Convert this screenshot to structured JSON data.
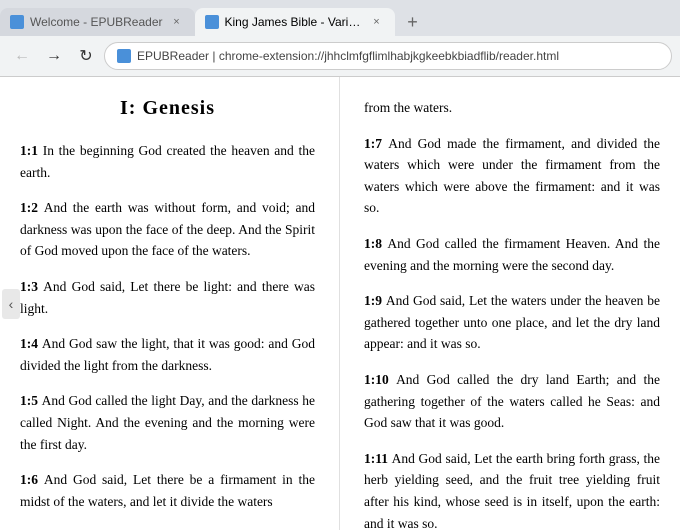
{
  "browser": {
    "tabs": [
      {
        "id": "tab1",
        "label": "Welcome - EPUBReader",
        "active": false,
        "favicon": "E"
      },
      {
        "id": "tab2",
        "label": "King James Bible - Various",
        "active": true,
        "favicon": "K"
      }
    ],
    "new_tab_label": "+",
    "nav": {
      "back": "←",
      "forward": "→",
      "reload": "↻"
    },
    "address": {
      "favicon": "E",
      "url": "EPUBReader  |  chrome-extension://jhhclmfgflimlhabjkgkeebkbiadflib/reader.html"
    }
  },
  "content": {
    "chapter_title": "I: Genesis",
    "left_verses": [
      {
        "ref": "1:1",
        "text": "In the beginning God created the heaven and the earth."
      },
      {
        "ref": "1:2",
        "text": "And the earth was without form, and void; and darkness was upon the face of the deep. And the Spirit of God moved upon the face of the waters."
      },
      {
        "ref": "1:3",
        "text": "And God said, Let there be light: and there was light."
      },
      {
        "ref": "1:4",
        "text": "And God saw the light, that it was good: and God divided the light from the darkness."
      },
      {
        "ref": "1:5",
        "text": "And God called the light Day, and the darkness he called Night. And the evening and the morning were the first day."
      },
      {
        "ref": "1:6",
        "text": "And God said, Let there be a firmament in the midst of the waters, and let it divide the waters"
      }
    ],
    "right_intro": "from the waters.",
    "right_verses": [
      {
        "ref": "1:7",
        "text": "And God made the firmament, and divided the waters which were under the firmament from the waters which were above the firmament: and it was so."
      },
      {
        "ref": "1:8",
        "text": "And God called the firmament Heaven. And the evening and the morning were the second day."
      },
      {
        "ref": "1:9",
        "text": "And God said, Let the waters under the heaven be gathered together unto one place, and let the dry land appear: and it was so."
      },
      {
        "ref": "1:10",
        "text": "And God called the dry land Earth; and the gathering together of the waters called he Seas: and God saw that it was good."
      },
      {
        "ref": "1:11",
        "text": "And God said, Let the earth bring forth grass, the herb yielding seed, and the fruit tree yielding fruit after his kind, whose seed is in itself, upon the earth: and it was so."
      }
    ]
  }
}
